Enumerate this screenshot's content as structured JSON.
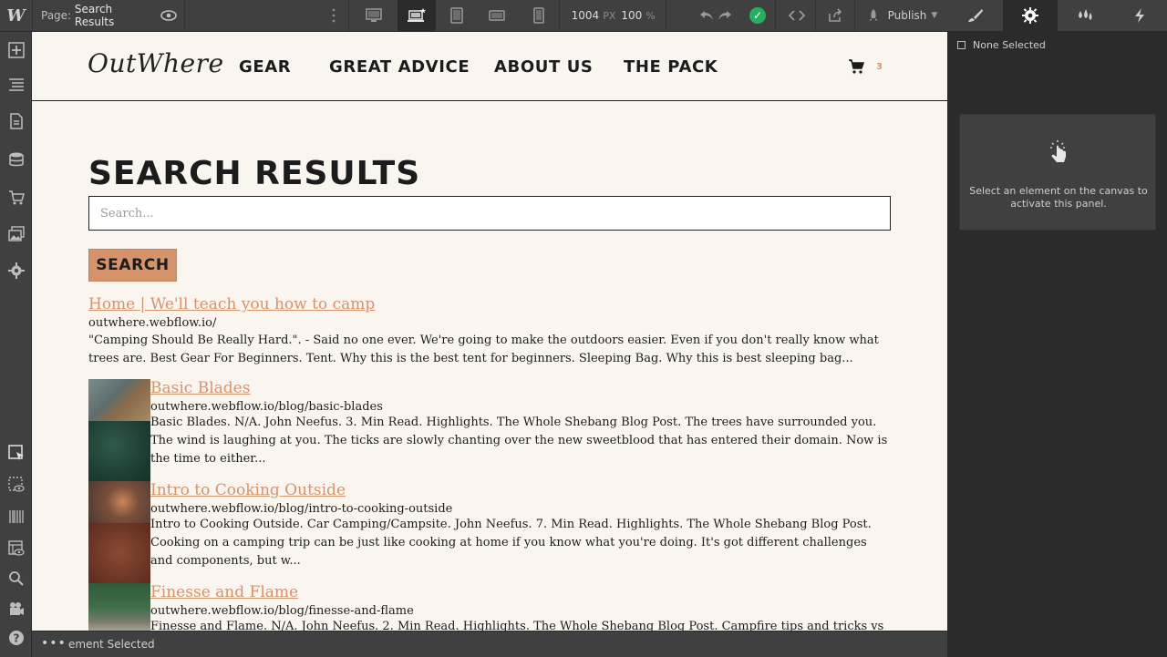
{
  "topbar": {
    "logo": "W",
    "page_label": "Page:",
    "page_name": "Search Results",
    "width_value": "1004",
    "width_unit": "PX",
    "zoom_value": "100",
    "zoom_unit": "%",
    "publish_label": "Publish"
  },
  "site": {
    "brand": "OutWhere",
    "nav": [
      "GEAR",
      "GREAT ADVICE",
      "ABOUT US",
      "THE PACK"
    ],
    "cart_count": "3"
  },
  "page": {
    "title": "SEARCH RESULTS",
    "search_placeholder": "Search...",
    "search_button": "SEARCH"
  },
  "results": [
    {
      "title": "Home | We'll teach you how to camp",
      "url": "outwhere.webflow.io/",
      "desc": "\"Camping Should Be Really Hard.\". - Said no one ever. We're going to make the outdoors easier. Even if you don't really know what trees are. Best Gear For Beginners. Tent. Why this is the best tent for beginners. Sleeping Bag. Why this is best sleeping bag..."
    },
    {
      "title": "Basic Blades",
      "url": "outwhere.webflow.io/blog/basic-blades",
      "desc": "Basic Blades. N/A. John Neefus. 3. Min Read. Highlights. The Whole Shebang Blog Post. The trees have surrounded you. The wind is laughing at you. The ticks are slowly chanting over the new sweetblood that has entered their domain. Now is the time to either..."
    },
    {
      "title": "Intro to Cooking Outside",
      "url": "outwhere.webflow.io/blog/intro-to-cooking-outside",
      "desc": "Intro to Cooking Outside. Car Camping/Campsite. John Neefus. 7. Min Read. Highlights. The Whole Shebang Blog Post. Cooking on a camping trip can be just like cooking at home if you know what you're doing. It's got different challenges and components, but w..."
    },
    {
      "title": "Finesse and Flame",
      "url": "outwhere.webflow.io/blog/finesse-and-flame",
      "desc": "Finesse and Flame. N/A. John Neefus. 2. Min Read. Highlights. The Whole Shebang Blog Post. Campfire tips and tricks vs camp..."
    }
  ],
  "right_panel": {
    "none_selected": "None Selected",
    "hint": "Select an element on the canvas to activate this panel."
  },
  "bottombar": {
    "dots": "•••",
    "breadcrumb": "ement Selected"
  },
  "colors": {
    "accent": "#d5936c",
    "canvas_bg": "#faf6ef",
    "ui_dark": "#404040",
    "panel_dark": "#2b2b2b",
    "status_green": "#27ae60"
  }
}
